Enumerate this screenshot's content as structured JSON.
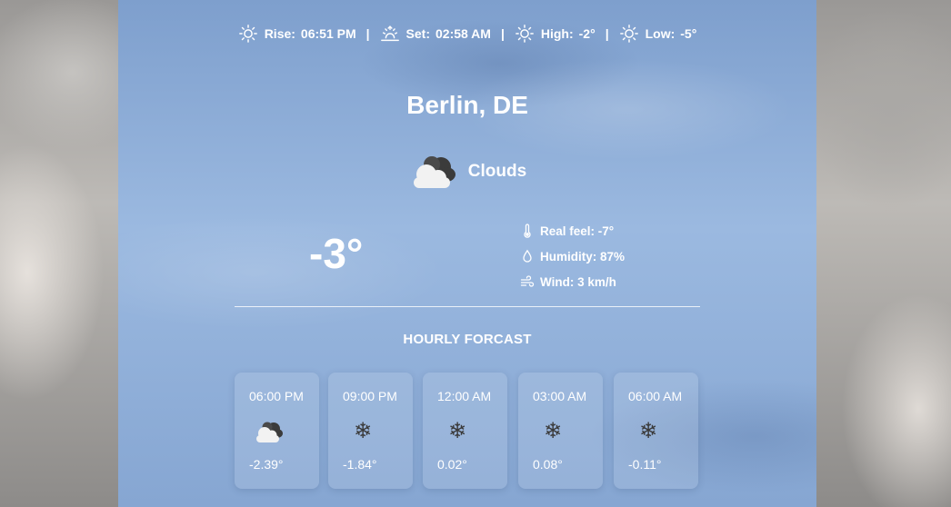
{
  "topbar": {
    "rise_label": "Rise:",
    "rise_value": "06:51 PM",
    "set_label": "Set:",
    "set_value": "02:58 AM",
    "high_label": "High:",
    "high_value": "-2°",
    "low_label": "Low:",
    "low_value": "-5°",
    "separator": "|",
    "icons": [
      "sun-icon",
      "sunset-icon",
      "sun-icon",
      "sun-icon"
    ]
  },
  "location": "Berlin, DE",
  "condition": {
    "icon": "clouds-icon",
    "label": "Clouds"
  },
  "temperature": "-3°",
  "details": {
    "real_feel": "Real feel: -7°",
    "humidity": "Humidity: 87%",
    "wind": "Wind: 3 km/h"
  },
  "hourly": {
    "title": "HOURLY FORCAST",
    "items": [
      {
        "time": "06:00 PM",
        "icon": "clouds-icon",
        "temp": "-2.39°"
      },
      {
        "time": "09:00 PM",
        "icon": "snowflake-icon",
        "temp": "-1.84°"
      },
      {
        "time": "12:00 AM",
        "icon": "snowflake-icon",
        "temp": "0.02°"
      },
      {
        "time": "03:00 AM",
        "icon": "snowflake-icon",
        "temp": "0.08°"
      },
      {
        "time": "06:00 AM",
        "icon": "snowflake-icon",
        "temp": "-0.11°"
      }
    ]
  },
  "colors": {
    "panel": "#8fb0da",
    "text": "#ffffff",
    "icon_dark": "#3a3a3a"
  }
}
